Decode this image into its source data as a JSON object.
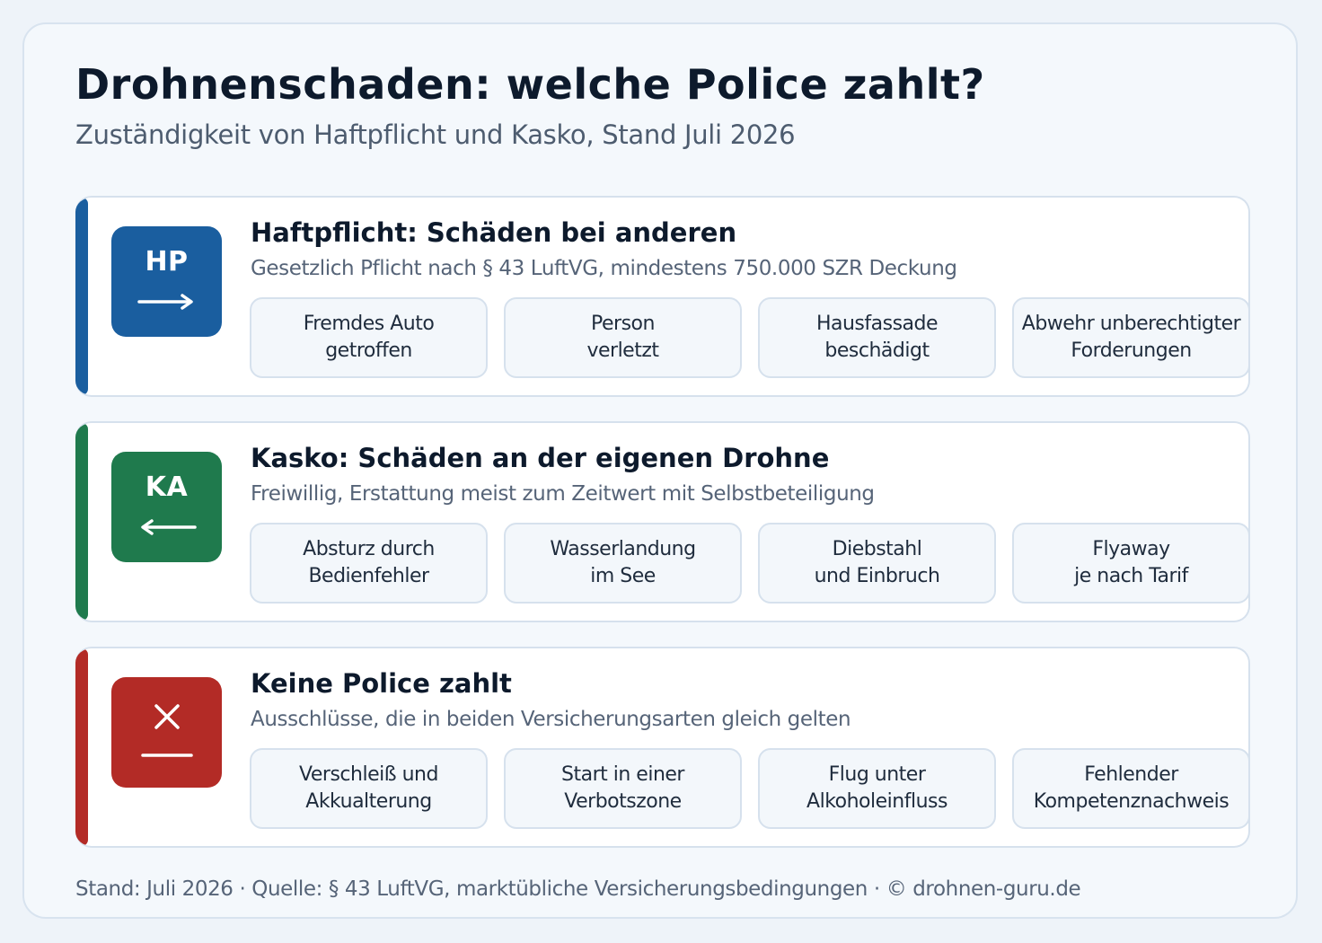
{
  "title": "Drohnenschaden: welche Police zahlt?",
  "subtitle": "Zuständigkeit von Haftpflicht und Kasko, Stand Juli 2026",
  "sections": [
    {
      "code": "HP",
      "icon": "arrow-right-icon",
      "color": "#1a5e9f",
      "title": "Haftpflicht: Schäden bei anderen",
      "description": "Gesetzlich Pflicht nach § 43 LuftVG, mindestens 750.000 SZR Deckung",
      "items": [
        {
          "line1": "Fremdes Auto",
          "line2": "getroffen"
        },
        {
          "line1": "Person",
          "line2": "verletzt"
        },
        {
          "line1": "Hausfassade",
          "line2": "beschädigt"
        },
        {
          "line1": "Abwehr unberechtigter",
          "line2": "Forderungen"
        }
      ]
    },
    {
      "code": "KA",
      "icon": "arrow-left-icon",
      "color": "#1f7a4d",
      "title": "Kasko: Schäden an der eigenen Drohne",
      "description": "Freiwillig, Erstattung meist zum Zeitwert mit Selbstbeteiligung",
      "items": [
        {
          "line1": "Absturz durch",
          "line2": "Bedienfehler"
        },
        {
          "line1": "Wasserlandung",
          "line2": "im See"
        },
        {
          "line1": "Diebstahl",
          "line2": "und Einbruch"
        },
        {
          "line1": "Flyaway",
          "line2": "je nach Tarif"
        }
      ]
    },
    {
      "code": "",
      "icon": "x-mark-icon",
      "color": "#b32b26",
      "title": "Keine Police zahlt",
      "description": "Ausschlüsse, die in beiden Versicherungsarten gleich gelten",
      "items": [
        {
          "line1": "Verschleiß und",
          "line2": "Akkualterung"
        },
        {
          "line1": "Start in einer",
          "line2": "Verbotszone"
        },
        {
          "line1": "Flug unter",
          "line2": "Alkoholeinfluss"
        },
        {
          "line1": "Fehlender",
          "line2": "Kompetenznachweis"
        }
      ]
    }
  ],
  "footer": "Stand: Juli 2026 · Quelle: § 43 LuftVG, marktübliche Versicherungsbedingungen · © drohnen-guru.de"
}
